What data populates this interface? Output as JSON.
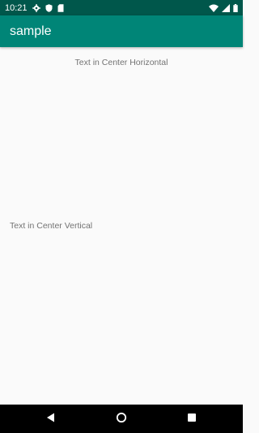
{
  "status_bar": {
    "time": "10:21",
    "icons": [
      "settings-icon",
      "shield-icon",
      "sd-card-icon",
      "wifi-icon",
      "cell-signal-icon",
      "battery-icon"
    ]
  },
  "app_bar": {
    "title": "sample"
  },
  "main": {
    "text_center_horizontal": "Text in Center Horizontal",
    "text_center_vertical": "Text in Center Vertical"
  },
  "nav_bar": {
    "buttons": [
      "back-icon",
      "home-icon",
      "recents-icon"
    ]
  },
  "colors": {
    "status_bar": "#00574b",
    "app_bar": "#008577",
    "background": "#fafafa",
    "text": "#737373",
    "nav_bar": "#000000"
  }
}
